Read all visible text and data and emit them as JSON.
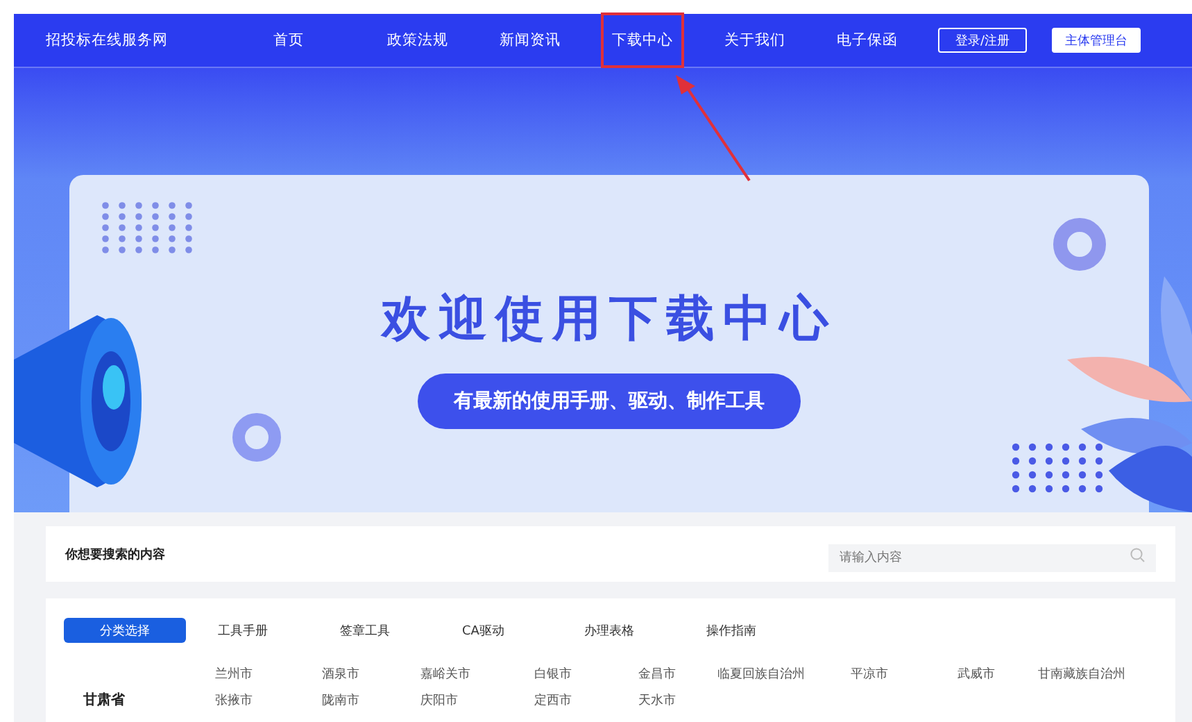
{
  "header": {
    "site_name": "招投标在线服务网",
    "nav": [
      {
        "label": "首页",
        "annotated": false
      },
      {
        "label": "政策法规",
        "annotated": false
      },
      {
        "label": "新闻资讯",
        "annotated": false
      },
      {
        "label": "下载中心",
        "annotated": true
      },
      {
        "label": "关于我们",
        "annotated": false
      },
      {
        "label": "电子保函",
        "annotated": false
      }
    ],
    "buttons": [
      {
        "label": "登录/注册",
        "kind": "outline"
      },
      {
        "label": "主体管理台",
        "kind": "solid"
      }
    ]
  },
  "banner": {
    "title": "欢迎使用下载中心",
    "subtitle": "有最新的使用手册、驱动、制作工具"
  },
  "search": {
    "label": "你想要搜索的内容",
    "placeholder": "请输入内容"
  },
  "tabs": [
    {
      "label": "分类选择",
      "selected": true
    },
    {
      "label": "工具手册",
      "selected": false
    },
    {
      "label": "签章工具",
      "selected": false
    },
    {
      "label": "CA驱动",
      "selected": false
    },
    {
      "label": "办理表格",
      "selected": false
    },
    {
      "label": "操作指南",
      "selected": false
    }
  ],
  "region": {
    "province": "甘肃省",
    "cities": [
      "兰州市",
      "酒泉市",
      "嘉峪关市",
      "白银市",
      "金昌市",
      "临夏回族自治州",
      "平凉市",
      "武威市",
      "甘南藏族自治州",
      "张掖市",
      "陇南市",
      "庆阳市",
      "定西市",
      "天水市"
    ]
  }
}
